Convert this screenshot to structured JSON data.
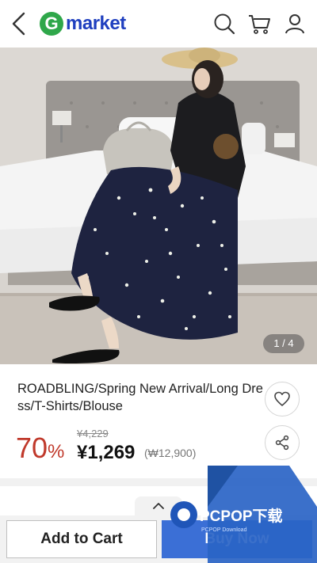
{
  "header": {
    "logo_letter": "G",
    "logo_text": "market"
  },
  "gallery": {
    "counter": "1 / 4"
  },
  "product": {
    "title": "ROADBLING/Spring New Arrival/Long Dress/T-Shirts/Blouse",
    "discount_number": "70",
    "discount_symbol": "%",
    "original_price": "¥4,229",
    "price": "¥1,269",
    "reference_price": "(₩12,900)"
  },
  "actions": {
    "add_to_cart": "Add to Cart",
    "buy_now": "Buy Now"
  },
  "watermark": {
    "brand": "PCPOP下载",
    "sub": "PCPOP Download"
  },
  "colors": {
    "accent_blue": "#3b6fd6",
    "logo_green": "#2fa74a",
    "logo_blue": "#1f3fbf",
    "discount_red": "#c0392b"
  }
}
